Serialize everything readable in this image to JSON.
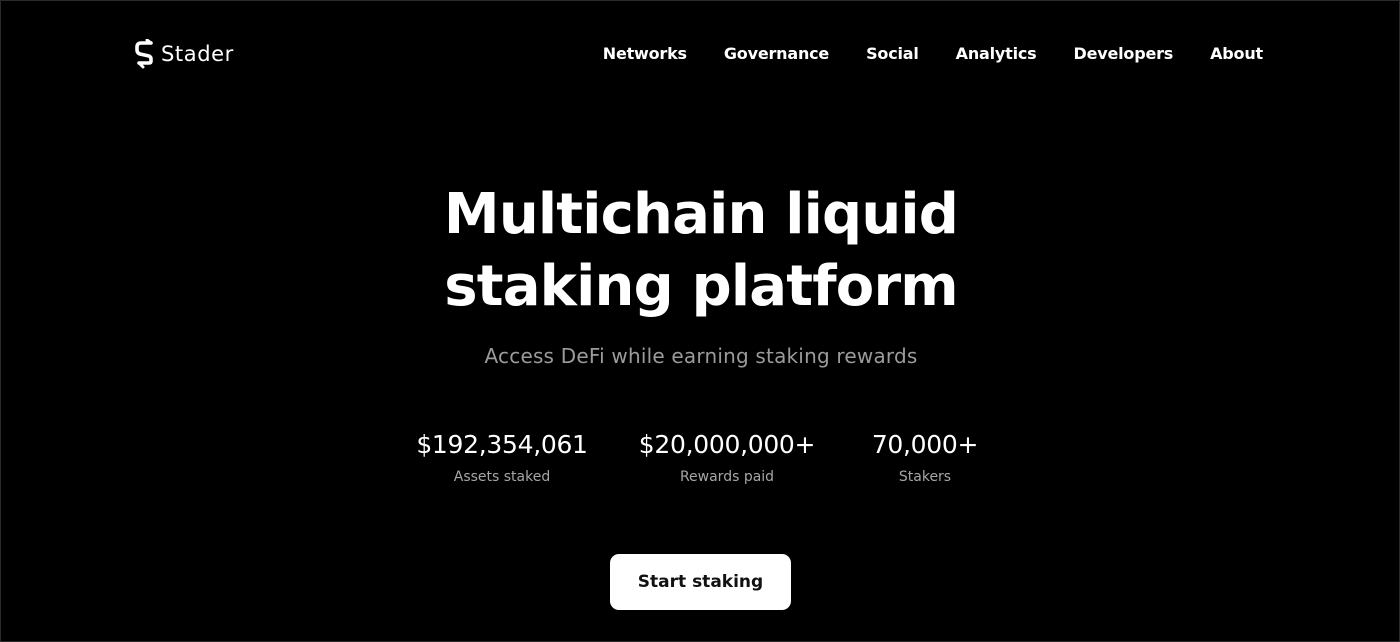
{
  "header": {
    "logo_text": "Stader",
    "logo_icon": "stader-s-logo-icon",
    "nav": [
      "Networks",
      "Governance",
      "Social",
      "Analytics",
      "Developers",
      "About"
    ]
  },
  "hero": {
    "headline_line1": "Multichain liquid",
    "headline_line2": "staking platform",
    "subtitle": "Access DeFi while earning staking rewards",
    "stats": [
      {
        "value": "$192,354,061",
        "label": "Assets staked"
      },
      {
        "value": "$20,000,000+",
        "label": "Rewards paid"
      },
      {
        "value": "70,000+",
        "label": "Stakers"
      }
    ],
    "cta_label": "Start staking"
  },
  "colors": {
    "background": "#000000",
    "text": "#ffffff",
    "muted": "#9b9b9b",
    "button_bg": "#ffffff",
    "button_text": "#111111"
  }
}
